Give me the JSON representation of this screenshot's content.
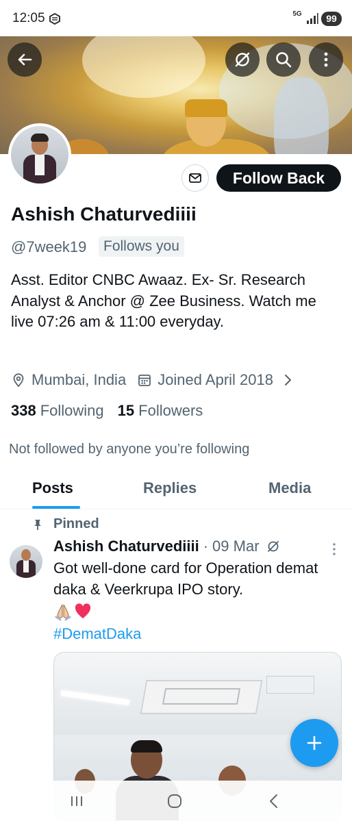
{
  "status_bar": {
    "time": "12:05",
    "network": "5G",
    "battery": "99"
  },
  "profile": {
    "name": "Ashish Chaturvediiii",
    "handle": "@7week19",
    "follows_you": "Follows you",
    "bio": "Asst. Editor CNBC Awaaz. Ex- Sr. Research Analyst & Anchor @ Zee Business. Watch me live 07:26 am & 11:00 everyday.",
    "location": "Mumbai, India",
    "joined": "Joined April 2018",
    "following_count": "338",
    "following_label": "Following",
    "followers_count": "15",
    "followers_label": "Followers",
    "not_followed": "Not followed by anyone you’re following",
    "follow_back_label": "Follow Back"
  },
  "tabs": [
    {
      "label": "Posts",
      "active": true
    },
    {
      "label": "Replies",
      "active": false
    },
    {
      "label": "Media",
      "active": false
    }
  ],
  "post": {
    "pinned_label": "Pinned",
    "author": "Ashish Chaturvediiii",
    "separator": "·",
    "date": "09 Mar",
    "text": "Got well-done card for Operation demat daka & Veerkrupa IPO story.",
    "hashtag": "#DematDaka"
  },
  "colors": {
    "accent": "#1d9bf0",
    "text_primary": "#0f1419",
    "text_secondary": "#536471",
    "button_dark": "#0f1419"
  },
  "icons": {
    "back": "arrow-left-icon",
    "hide": "eye-off-icon",
    "search": "search-icon",
    "more": "more-vertical-icon",
    "message": "mail-icon",
    "location": "location-pin-icon",
    "calendar": "calendar-icon",
    "pin": "pin-icon",
    "compose": "plus-icon"
  }
}
